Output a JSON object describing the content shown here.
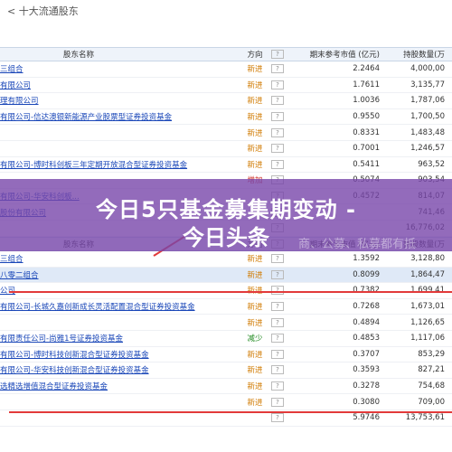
{
  "title": "< 十大流通股东",
  "header": {
    "name": "股东名称",
    "dir": "方向",
    "q": "?",
    "val": "期末参考市值 (亿元)",
    "sh": "持股数量(万"
  },
  "table1": [
    {
      "name": "三组合",
      "dir": "新进",
      "cls": "new",
      "val": "2.2464",
      "sh": "4,000,00"
    },
    {
      "name": "有限公司",
      "dir": "新进",
      "cls": "new",
      "val": "1.7611",
      "sh": "3,135,77"
    },
    {
      "name": "理有限公司",
      "dir": "新进",
      "cls": "new",
      "val": "1.0036",
      "sh": "1,787,06"
    },
    {
      "name": "有限公司-信达澳银新能源产业股票型证券投资基金",
      "dir": "新进",
      "cls": "new",
      "val": "0.9550",
      "sh": "1,700,50"
    },
    {
      "name": "",
      "dir": "新进",
      "cls": "new",
      "val": "0.8331",
      "sh": "1,483,48"
    },
    {
      "name": "",
      "dir": "新进",
      "cls": "new",
      "val": "0.7001",
      "sh": "1,246,57"
    },
    {
      "name": "有限公司-博时科创板三年定期开放混合型证券投资基金",
      "dir": "新进",
      "cls": "new",
      "val": "0.5411",
      "sh": "963,52"
    },
    {
      "name": "",
      "dir": "增加",
      "cls": "inc",
      "val": "0.5074",
      "sh": "903,54"
    },
    {
      "name": "有限公司-华安科创板...",
      "dir": "",
      "cls": "new",
      "val": "0.4572",
      "sh": "814,07"
    },
    {
      "name": "股份有限公司",
      "dir": "",
      "cls": "new",
      "val": "",
      "sh": "741,46"
    },
    {
      "name": "",
      "dir": "",
      "cls": "new",
      "val": "",
      "sh": "16,776,02"
    }
  ],
  "banner": {
    "line1": "今日5只基金募集期变动 -",
    "line2": "今日头条",
    "bg": "商、公募、私募都有抵"
  },
  "table2": [
    {
      "name": "三组合",
      "dir": "新进",
      "cls": "new",
      "val": "1.3592",
      "sh": "3,128,80",
      "hl": false
    },
    {
      "name": "八零二组合",
      "dir": "新进",
      "cls": "new",
      "val": "0.8099",
      "sh": "1,864,47",
      "hl": true
    },
    {
      "name": "公司",
      "dir": "新进",
      "cls": "new",
      "val": "0.7382",
      "sh": "1,699,41",
      "hl": false
    },
    {
      "name": "有限公司-长城久嘉创新成长灵活配置混合型证券投资基金",
      "dir": "新进",
      "cls": "new",
      "val": "0.7268",
      "sh": "1,673,01",
      "hl": false
    },
    {
      "name": "",
      "dir": "新进",
      "cls": "new",
      "val": "0.4894",
      "sh": "1,126,65",
      "hl": false
    },
    {
      "name": "有限责任公司-尚雅1号证券投资基金",
      "dir": "减少",
      "cls": "dec",
      "val": "0.4853",
      "sh": "1,117,06",
      "hl": false
    },
    {
      "name": "有限公司-博时科技创新混合型证券投资基金",
      "dir": "新进",
      "cls": "new",
      "val": "0.3707",
      "sh": "853,29",
      "hl": false
    },
    {
      "name": "有限公司-华安科技创新混合型证券投资基金",
      "dir": "新进",
      "cls": "new",
      "val": "0.3593",
      "sh": "827,21",
      "hl": false
    },
    {
      "name": "选精选增值混合型证券投资基金",
      "dir": "新进",
      "cls": "new",
      "val": "0.3278",
      "sh": "754,68",
      "hl": false
    },
    {
      "name": "",
      "dir": "新进",
      "cls": "new",
      "val": "0.3080",
      "sh": "709,00",
      "hl": false
    },
    {
      "name": "",
      "dir": "",
      "cls": "new",
      "val": "5.9746",
      "sh": "13,753,61",
      "hl": false
    }
  ]
}
